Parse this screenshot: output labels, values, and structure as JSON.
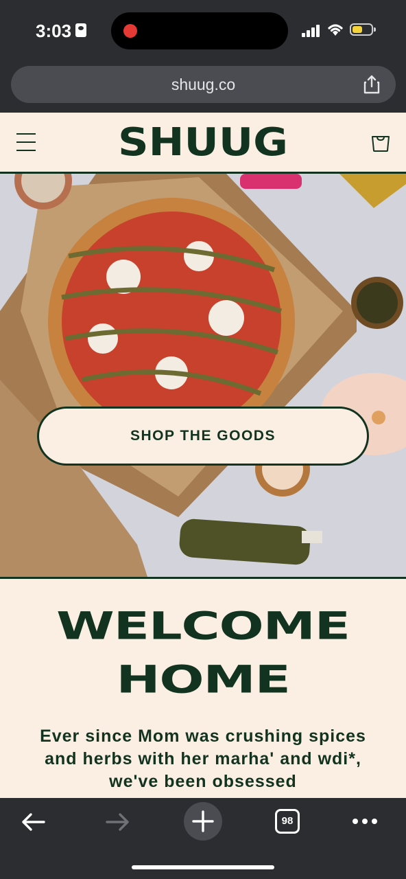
{
  "status_bar": {
    "time": "3:03",
    "icons": [
      "id-badge-icon",
      "recording-dot-icon",
      "signal-icon",
      "wifi-icon",
      "battery-icon"
    ],
    "recording_color": "#e53935",
    "battery_color": "#f5d33b"
  },
  "browser": {
    "url": "shuug.co",
    "share_icon": "share-icon"
  },
  "site_header": {
    "logo_text": "SHUUG",
    "menu_icon": "hamburger-menu-icon",
    "cart_icon": "shopping-bag-icon",
    "brand_color": "#12331f",
    "background_color": "#fbefe3"
  },
  "hero": {
    "image_description_icon": "pizza-hero-image",
    "cta_label": "SHOP THE GOODS"
  },
  "welcome": {
    "heading_line1": "WELCOME",
    "heading_line2": "HOME",
    "body": "Ever since Mom was crushing spices and herbs with her marha' and wdi*, we've been obsessed"
  },
  "bottom_toolbar": {
    "back_icon": "back-arrow-icon",
    "forward_icon": "forward-arrow-icon",
    "new_tab_icon": "plus-icon",
    "tab_count": "98",
    "more_icon": "more-dots-icon"
  }
}
